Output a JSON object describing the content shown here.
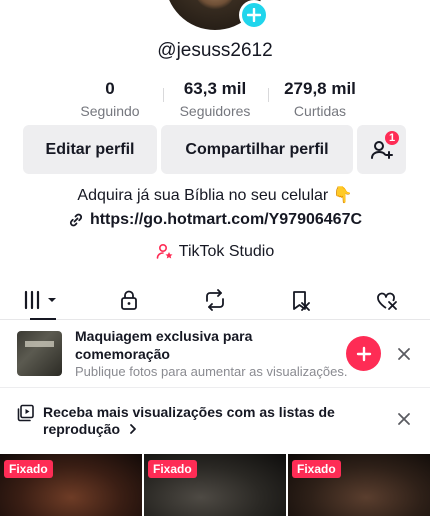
{
  "profile": {
    "username": "@jesuss2612",
    "stats": [
      {
        "value": "0",
        "label": "Seguindo"
      },
      {
        "value": "63,3 mil",
        "label": "Seguidores"
      },
      {
        "value": "279,8 mil",
        "label": "Curtidas"
      }
    ],
    "buttons": {
      "edit": "Editar perfil",
      "share": "Compartilhar perfil",
      "friend_badge": "1"
    },
    "bio": "Adquira já sua Bíblia no seu celular 👇",
    "link": "https://go.hotmart.com/Y97906467C",
    "studio": "TikTok Studio"
  },
  "tabs": [
    {
      "icon": "grid-videos-icon",
      "active": true
    },
    {
      "icon": "lock-icon",
      "active": false
    },
    {
      "icon": "repost-icon",
      "active": false
    },
    {
      "icon": "bookmark-icon",
      "active": false
    },
    {
      "icon": "liked-heart-icon",
      "active": false
    }
  ],
  "promo": {
    "title": "Maquiagem exclusiva para comemoração",
    "subtitle": "Publique fotos para aumentar as visualizações."
  },
  "playlist": {
    "text": "Receba mais visualizações com as listas de reprodução"
  },
  "videos": [
    {
      "pinned_label": "Fixado"
    },
    {
      "pinned_label": "Fixado"
    },
    {
      "pinned_label": "Fixado"
    }
  ],
  "colors": {
    "accent": "#fe2c55",
    "cyan": "#20d5ec"
  }
}
